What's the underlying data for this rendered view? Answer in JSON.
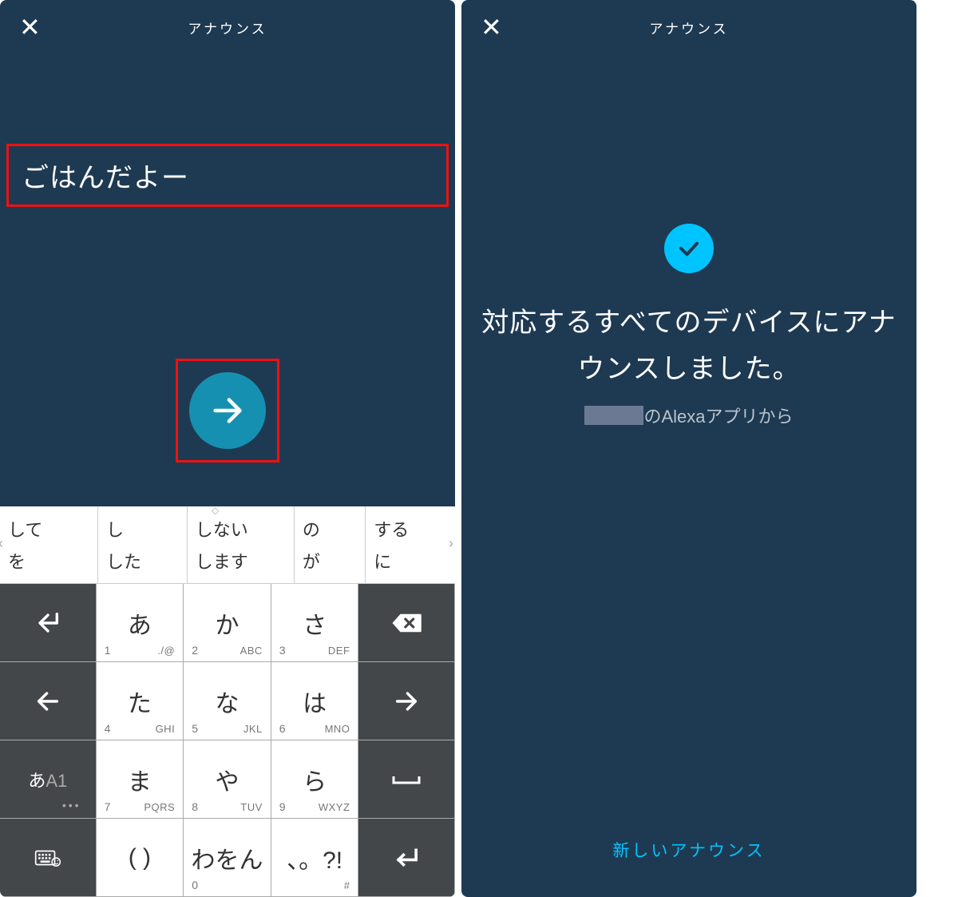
{
  "left": {
    "header": {
      "title": "アナウンス"
    },
    "input": {
      "value": "ごはんだよー"
    },
    "suggestions": {
      "col1": [
        "して",
        "を"
      ],
      "col2": [
        "し",
        "した"
      ],
      "col3": [
        "しない",
        "します"
      ],
      "col4": [
        "の",
        "が"
      ],
      "col5": [
        "する",
        "に"
      ]
    },
    "keys": {
      "r1": {
        "k1": "あ",
        "k1n": "1",
        "k1a": "./@",
        "k2": "か",
        "k2n": "2",
        "k2a": "ABC",
        "k3": "さ",
        "k3n": "3",
        "k3a": "DEF"
      },
      "r2": {
        "k1": "た",
        "k1n": "4",
        "k1a": "GHI",
        "k2": "な",
        "k2n": "5",
        "k2a": "JKL",
        "k3": "は",
        "k3n": "6",
        "k3a": "MNO"
      },
      "r3": {
        "mode_hl": "あ",
        "mode_dim": "A1",
        "k1": "ま",
        "k1n": "7",
        "k1a": "PQRS",
        "k2": "や",
        "k2n": "8",
        "k2a": "TUV",
        "k3": "ら",
        "k3n": "9",
        "k3a": "WXYZ"
      },
      "r4": {
        "k1": "( )",
        "k2": "わをん",
        "k2n": "0",
        "k3": "、。?!",
        "k3a": "#"
      }
    }
  },
  "right": {
    "header": {
      "title": "アナウンス"
    },
    "message": "対応するすべてのデバイスにアナウンスしました。",
    "from_suffix": "のAlexaアプリから",
    "new_announce": "新しいアナウンス"
  }
}
